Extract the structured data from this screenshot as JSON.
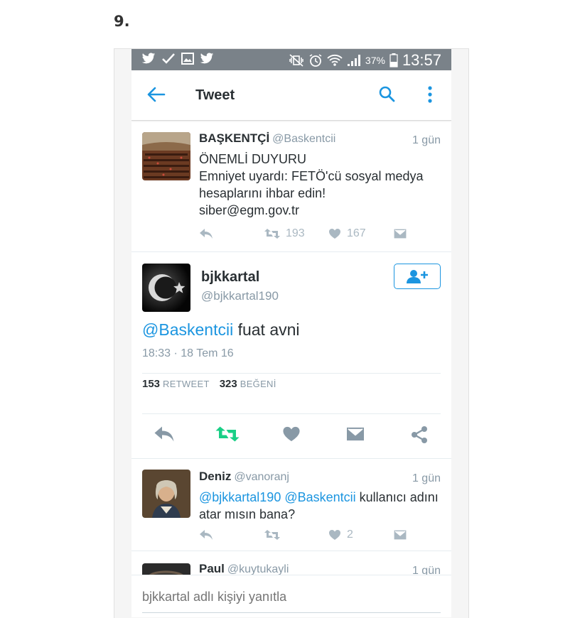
{
  "page_number": "9.",
  "status_bar": {
    "battery_percent": "37%",
    "time": "13:57"
  },
  "app_bar": {
    "title": "Tweet"
  },
  "tweets": [
    {
      "name": "BAŞKENTÇİ",
      "handle": "@Baskentcii",
      "time": "1 gün",
      "lines": [
        "ÖNEMLİ DUYURU",
        "Emniyet uyardı: FETÖ'cü sosyal medya",
        "hesaplarını ihbar edin!",
        "siber@egm.gov.tr"
      ],
      "retweets": "193",
      "likes": "167"
    }
  ],
  "main_tweet": {
    "name": "bjkkartal",
    "handle": "@bjkkartal190",
    "mention": "@Baskentcii",
    "text": " fuat avni",
    "timestamp": "18:33 · 18 Tem 16",
    "retweet_count": "153",
    "retweet_label": "RETWEET",
    "like_count": "323",
    "like_label": "BEĞENİ"
  },
  "replies": [
    {
      "name": "Deniz",
      "handle": "@vanoranj",
      "time": "1 gün",
      "mention1": "@bjkkartal190",
      "mention2": "@Baskentcii",
      "text_line1_rest": " kullanıcı adını",
      "text_line2": "atar mısın bana?",
      "likes": "2"
    },
    {
      "name": "Paul",
      "handle": "@kuytukayli",
      "time": "1 gün"
    }
  ],
  "reply_bar": {
    "placeholder": "bjkkartal adlı kişiyi yanıtla"
  },
  "colors": {
    "accent": "#1b95e0",
    "retweet_green": "#19cf86",
    "status_bar": "#7a8289",
    "muted": "#8899a6"
  }
}
